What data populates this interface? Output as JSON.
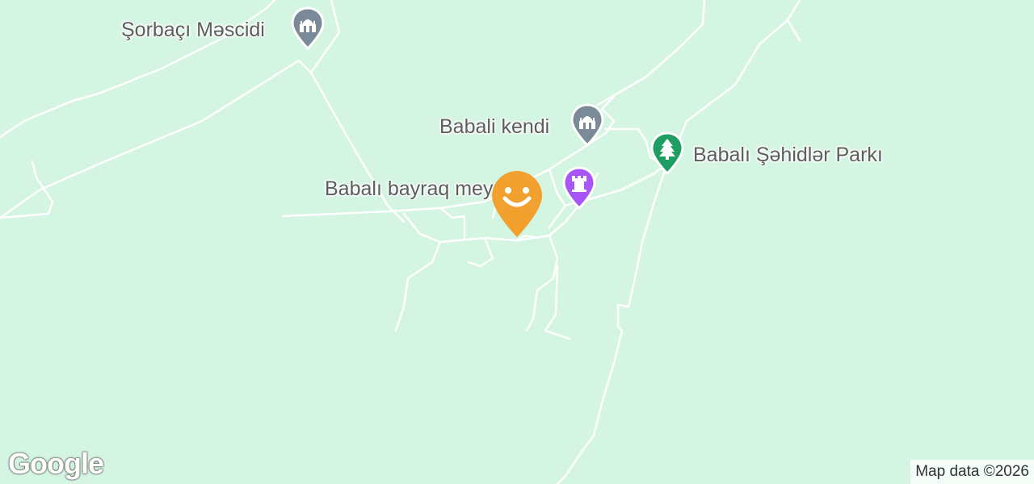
{
  "places": [
    {
      "name": "Şorbaçı Məscidi",
      "icon": "mosque-icon",
      "color": "#7a8a99"
    },
    {
      "name": "Babali kendi",
      "icon": "mosque-icon",
      "color": "#7a8a99"
    },
    {
      "name": "Babalı bayraq meydanı",
      "icon": "castle-icon",
      "color": "#a855f7"
    },
    {
      "name": "Babalı Şəhidlər Parkı",
      "icon": "tree-icon",
      "color": "#1e9e63"
    }
  ],
  "selected_marker": {
    "icon": "smiley-icon",
    "color": "#f2a12e"
  },
  "logo": {
    "text": "Google"
  },
  "attribution": {
    "text": "Map data ©2026"
  },
  "colors": {
    "land": "#d3f5e1",
    "road": "#ffffff"
  }
}
